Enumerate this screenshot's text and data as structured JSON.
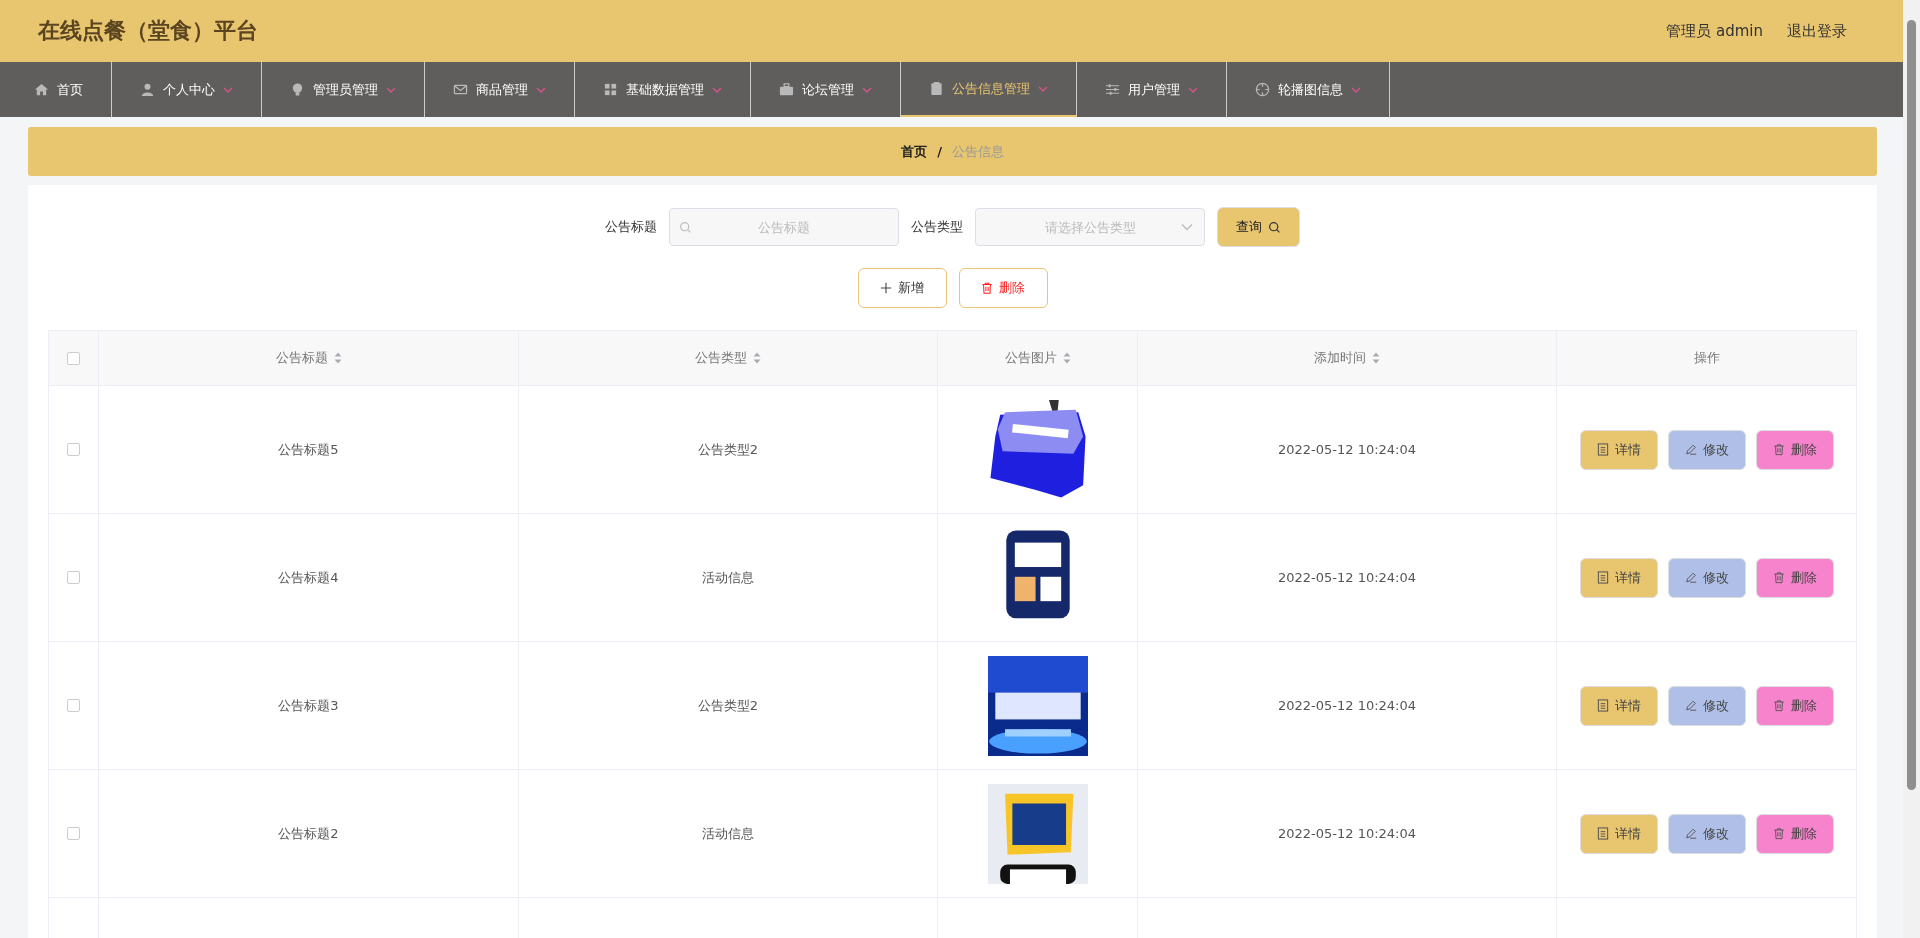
{
  "header": {
    "title": "在线点餐（堂食）平台",
    "user": "管理员 admin",
    "logout": "退出登录"
  },
  "nav": [
    {
      "label": "首页",
      "dropdown": false,
      "selected": false
    },
    {
      "label": "个人中心",
      "dropdown": true,
      "selected": false
    },
    {
      "label": "管理员管理",
      "dropdown": true,
      "selected": false
    },
    {
      "label": "商品管理",
      "dropdown": true,
      "selected": false
    },
    {
      "label": "基础数据管理",
      "dropdown": true,
      "selected": false
    },
    {
      "label": "论坛管理",
      "dropdown": true,
      "selected": false
    },
    {
      "label": "公告信息管理",
      "dropdown": true,
      "selected": true
    },
    {
      "label": "用户管理",
      "dropdown": true,
      "selected": false
    },
    {
      "label": "轮播图信息",
      "dropdown": true,
      "selected": false
    }
  ],
  "breadcrumb": {
    "home": "首页",
    "separator": "/",
    "current": "公告信息"
  },
  "search": {
    "title_label": "公告标题",
    "title_placeholder": "公告标题",
    "type_label": "公告类型",
    "type_placeholder": "请选择公告类型",
    "query": "查询"
  },
  "actions": {
    "add": "新增",
    "delete": "删除"
  },
  "table": {
    "columns": [
      {
        "label": "公告标题",
        "sortable": true
      },
      {
        "label": "公告类型",
        "sortable": true
      },
      {
        "label": "公告图片",
        "sortable": true
      },
      {
        "label": "添加时间",
        "sortable": true
      },
      {
        "label": "操作",
        "sortable": false
      }
    ],
    "select_all": {
      "checked": false
    },
    "rows": [
      {
        "checked": false,
        "title": "公告标题5",
        "type": "公告类型2",
        "time": "2022-05-12 10:24:04",
        "detail": "详情",
        "edit": "修改",
        "delete": "删除"
      },
      {
        "checked": false,
        "title": "公告标题4",
        "type": "活动信息",
        "time": "2022-05-12 10:24:04",
        "detail": "详情",
        "edit": "修改",
        "delete": "删除"
      },
      {
        "checked": false,
        "title": "公告标题3",
        "type": "公告类型2",
        "time": "2022-05-12 10:24:04",
        "detail": "详情",
        "edit": "修改",
        "delete": "删除"
      },
      {
        "checked": false,
        "title": "公告标题2",
        "type": "活动信息",
        "time": "2022-05-12 10:24:04",
        "detail": "详情",
        "edit": "修改",
        "delete": "删除"
      }
    ]
  }
}
